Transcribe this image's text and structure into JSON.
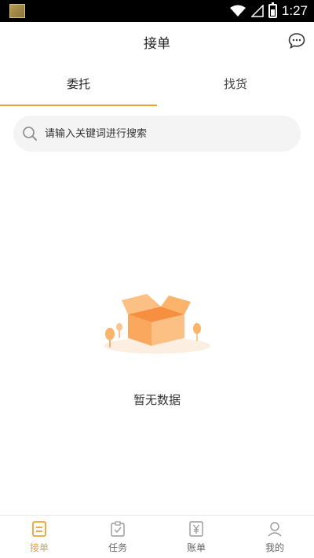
{
  "status_bar": {
    "time": "1:27"
  },
  "header": {
    "title": "接单"
  },
  "tabs": [
    {
      "label": "委托",
      "active": true
    },
    {
      "label": "找货",
      "active": false
    }
  ],
  "search": {
    "placeholder": "请输入关键词进行搜索",
    "value": ""
  },
  "empty_state": {
    "text": "暂无数据"
  },
  "bottom_nav": [
    {
      "label": "接单",
      "icon": "list-icon",
      "active": true
    },
    {
      "label": "任务",
      "icon": "clipboard-icon",
      "active": false
    },
    {
      "label": "账单",
      "icon": "yen-bill-icon",
      "active": false
    },
    {
      "label": "我的",
      "icon": "user-icon",
      "active": false
    }
  ],
  "colors": {
    "accent": "#f0a030",
    "box": "#fbb46a"
  }
}
